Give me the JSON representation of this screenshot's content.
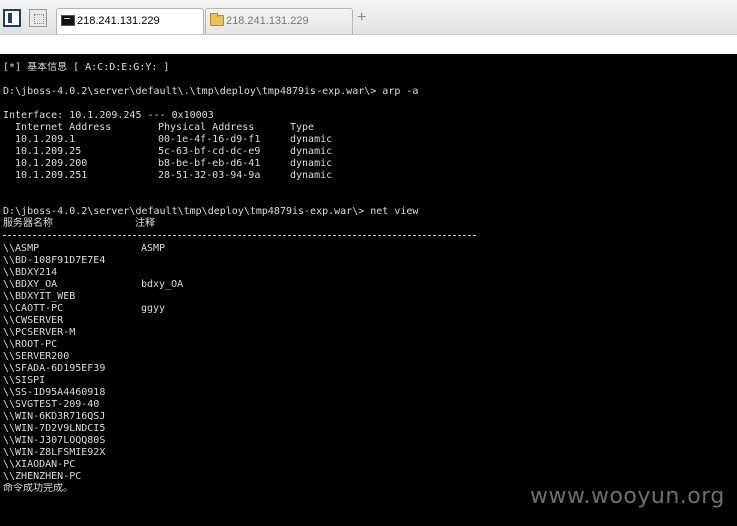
{
  "tabs": [
    {
      "label": "218.241.131.229",
      "active": true,
      "icon": "terminal-icon"
    },
    {
      "label": "218.241.131.229",
      "active": false,
      "icon": "folder-icon"
    }
  ],
  "new_tab_label": "+",
  "console": {
    "basic_info": "[*] 基本信息 [ A:C:D:E:G:Y: ]",
    "cmd_arp": "D:\\jboss-4.0.2\\server\\default\\.\\tmp\\deploy\\tmp4879is-exp.war\\> arp -a",
    "interface_line": "Interface: 10.1.209.245 --- 0x10003",
    "arp_headers": [
      "Internet Address",
      "Physical Address",
      "Type"
    ],
    "arp_rows": [
      [
        "10.1.209.1",
        "00-1e-4f-16-d9-f1",
        "dynamic"
      ],
      [
        "10.1.209.25",
        "5c-63-bf-cd-dc-e9",
        "dynamic"
      ],
      [
        "10.1.209.200",
        "b8-be-bf-eb-d6-41",
        "dynamic"
      ],
      [
        "10.1.209.251",
        "28-51-32-03-94-9a",
        "dynamic"
      ]
    ],
    "cmd_net_view": "D:\\jboss-4.0.2\\server\\default\\tmp\\deploy\\tmp4879is-exp.war\\> net view",
    "net_headers": [
      "服务器名称",
      "注释"
    ],
    "servers": [
      [
        "\\\\ASMP",
        "ASMP"
      ],
      [
        "\\\\BD-108F91D7E7E4",
        ""
      ],
      [
        "\\\\BDXY214",
        ""
      ],
      [
        "\\\\BDXY_OA",
        "bdxy_OA"
      ],
      [
        "\\\\BDXYIT_WEB",
        ""
      ],
      [
        "\\\\CAOTT-PC",
        "ggyy"
      ],
      [
        "\\\\CWSERVER",
        ""
      ],
      [
        "\\\\PCSERVER-M",
        ""
      ],
      [
        "\\\\ROOT-PC",
        ""
      ],
      [
        "\\\\SERVER200",
        ""
      ],
      [
        "\\\\SFADA-6D195EF39",
        ""
      ],
      [
        "\\\\SISPI",
        ""
      ],
      [
        "\\\\SS-1D95A4460918",
        ""
      ],
      [
        "\\\\SVGTEST-209-40",
        ""
      ],
      [
        "\\\\WIN-6KD3R716QSJ",
        ""
      ],
      [
        "\\\\WIN-7D2V9LNDCI5",
        ""
      ],
      [
        "\\\\WIN-J307LOQQ80S",
        ""
      ],
      [
        "\\\\WIN-Z8LFSMIE92X",
        ""
      ],
      [
        "\\\\XIAODAN-PC",
        ""
      ],
      [
        "\\\\ZHENZHEN-PC",
        ""
      ]
    ],
    "done_message": "命令成功完成。"
  },
  "watermark": "www.wooyun.org"
}
